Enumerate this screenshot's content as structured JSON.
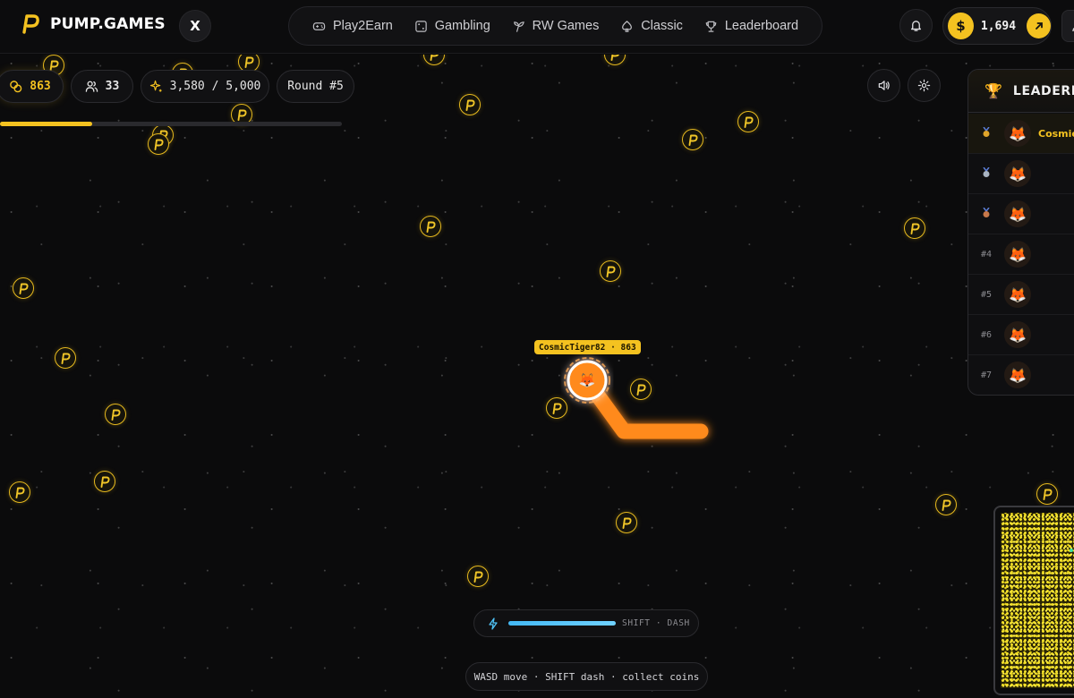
{
  "brand": {
    "name": "PUMP.GAMES",
    "x_label": "X"
  },
  "nav": [
    {
      "label": "Play2Earn",
      "icon": "gamepad-icon"
    },
    {
      "label": "Gambling",
      "icon": "dice-icon"
    },
    {
      "label": "RW Games",
      "icon": "plant-icon"
    },
    {
      "label": "Classic",
      "icon": "spade-icon"
    },
    {
      "label": "Leaderboard",
      "icon": "trophy-icon"
    }
  ],
  "wallet": {
    "currency_symbol": "$",
    "balance": "1,694"
  },
  "hud": {
    "coins": "863",
    "players": "33",
    "progress": "3,580 / 5,000",
    "progress_fraction": 0.27,
    "round": "Round #5"
  },
  "leaderboard": {
    "title": "LEADERBOARD",
    "rows": [
      {
        "rank": "1",
        "medal": "gold",
        "name": "Cosmic",
        "me": true
      },
      {
        "rank": "2",
        "medal": "silver",
        "name": ""
      },
      {
        "rank": "3",
        "medal": "bronze",
        "name": ""
      },
      {
        "rank": "#4",
        "name": ""
      },
      {
        "rank": "#5",
        "name": ""
      },
      {
        "rank": "#6",
        "name": ""
      },
      {
        "rank": "#7",
        "name": ""
      }
    ]
  },
  "player": {
    "tag": "CosmicTiger82 · 863",
    "avatar": "🦊"
  },
  "dash": {
    "label": "SHIFT · DASH",
    "fill_fraction": 1.0
  },
  "help": {
    "text": "WASD move · SHIFT dash · collect coins"
  },
  "colors": {
    "accent": "#f4c220",
    "snake": "#ff8a1f",
    "dash": "#4fc3f7"
  }
}
